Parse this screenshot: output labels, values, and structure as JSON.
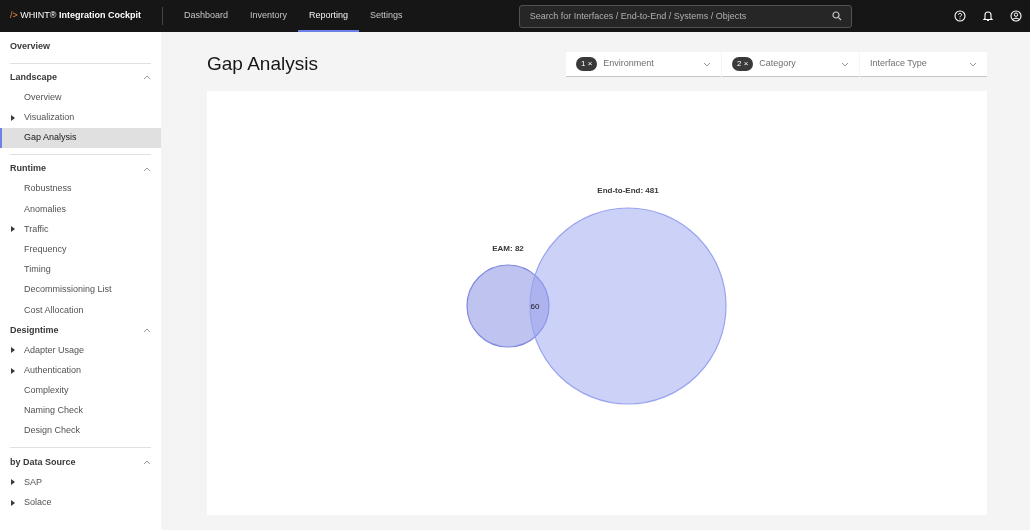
{
  "brand": {
    "prefix": "/>",
    "name": "WHINT®",
    "product": "Integration Cockpit"
  },
  "nav_tabs": [
    {
      "label": "Dashboard",
      "selected": false
    },
    {
      "label": "Inventory",
      "selected": false
    },
    {
      "label": "Reporting",
      "selected": true
    },
    {
      "label": "Settings",
      "selected": false
    }
  ],
  "search": {
    "placeholder": "Search for Interfaces / End-to-End / Systems / Objects"
  },
  "sidebar": {
    "sections": [
      {
        "title": "Overview",
        "separator_above": false
      },
      {
        "title": "Landscape",
        "separator_above": true,
        "expanded": true,
        "items": [
          {
            "label": "Overview",
            "expandable": false,
            "selected": false
          },
          {
            "label": "Visualization",
            "expandable": true,
            "selected": false
          },
          {
            "label": "Gap Analysis",
            "expandable": false,
            "selected": true
          }
        ]
      },
      {
        "title": "Runtime",
        "separator_above": true,
        "expanded": true,
        "items": [
          {
            "label": "Robustness",
            "expandable": false,
            "selected": false
          },
          {
            "label": "Anomalies",
            "expandable": false,
            "selected": false
          },
          {
            "label": "Traffic",
            "expandable": true,
            "selected": false
          },
          {
            "label": "Frequency",
            "expandable": false,
            "selected": false
          },
          {
            "label": "Timing",
            "expandable": false,
            "selected": false
          },
          {
            "label": "Decommissioning List",
            "expandable": false,
            "selected": false
          },
          {
            "label": "Cost Allocation",
            "expandable": false,
            "selected": false
          }
        ]
      },
      {
        "title": "Designtime",
        "separator_above": false,
        "expanded": true,
        "items": [
          {
            "label": "Adapter Usage",
            "expandable": true,
            "selected": false
          },
          {
            "label": "Authentication",
            "expandable": true,
            "selected": false
          },
          {
            "label": "Complexity",
            "expandable": false,
            "selected": false
          },
          {
            "label": "Naming Check",
            "expandable": false,
            "selected": false
          },
          {
            "label": "Design Check",
            "expandable": false,
            "selected": false
          }
        ]
      },
      {
        "title": "by Data Source",
        "separator_above": true,
        "expanded": true,
        "items": [
          {
            "label": "SAP",
            "expandable": true,
            "selected": false
          },
          {
            "label": "Solace",
            "expandable": true,
            "selected": false
          }
        ]
      }
    ]
  },
  "page_title": "Gap Analysis",
  "filters": [
    {
      "label": "Environment",
      "count": "1",
      "clear": "×"
    },
    {
      "label": "Category",
      "count": "2",
      "clear": "×"
    },
    {
      "label": "Interface Type"
    }
  ],
  "venn": {
    "sets": [
      {
        "label": "EAM: 82",
        "color": "#8088e0"
      },
      {
        "label": "End-to-End: 481",
        "color": "#9aa4f0"
      }
    ],
    "intersection": "60"
  }
}
